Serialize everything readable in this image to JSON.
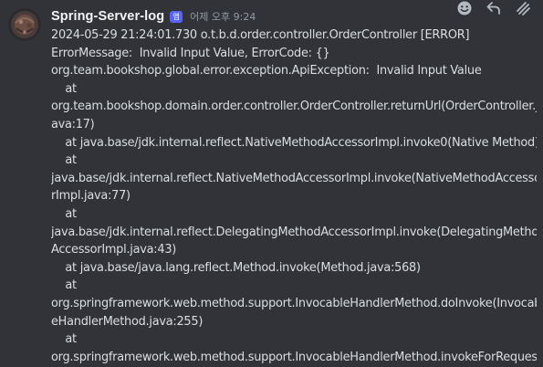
{
  "message": {
    "author": "Spring-Server-log",
    "badge": "앱",
    "timestamp": "어제 오후 9:24",
    "lines": [
      "2024-05-29 21:24:01.730 o.t.b.d.order.controller.OrderController [ERROR]",
      "ErrorMessage:  Invalid Input Value, ErrorCode: {}",
      "org.team.bookshop.global.error.exception.ApiException:  Invalid Input Value",
      "    at",
      "org.team.bookshop.domain.order.controller.OrderController.returnUrl(OrderController.j",
      "ava:17)",
      "    at java.base/jdk.internal.reflect.NativeMethodAccessorImpl.invoke0(Native Method)",
      "    at",
      "java.base/jdk.internal.reflect.NativeMethodAccessorImpl.invoke(NativeMethodAccessor",
      "rImpl.java:77)",
      "    at",
      "java.base/jdk.internal.reflect.DelegatingMethodAccessorImpl.invoke(DelegatingMethod",
      "AccessorImpl.java:43)",
      "    at java.base/java.lang.reflect.Method.invoke(Method.java:568)",
      "    at",
      "org.springframework.web.method.support.InvocableHandlerMethod.doInvoke(Invocabl",
      "eHandlerMethod.java:255)",
      "    at",
      "org.springframework.web.method.support.InvocableHandlerMethod.invokeForRequest"
    ]
  },
  "toolbar": {
    "icons": [
      "add-reaction-icon",
      "reply-icon",
      "more-options-icon"
    ]
  },
  "colors": {
    "background": "#313338",
    "text": "#dbdee1",
    "username": "#f2f3f5",
    "timestamp": "#949ba4",
    "badge": "#5865f2",
    "icon": "#b5bac1"
  }
}
